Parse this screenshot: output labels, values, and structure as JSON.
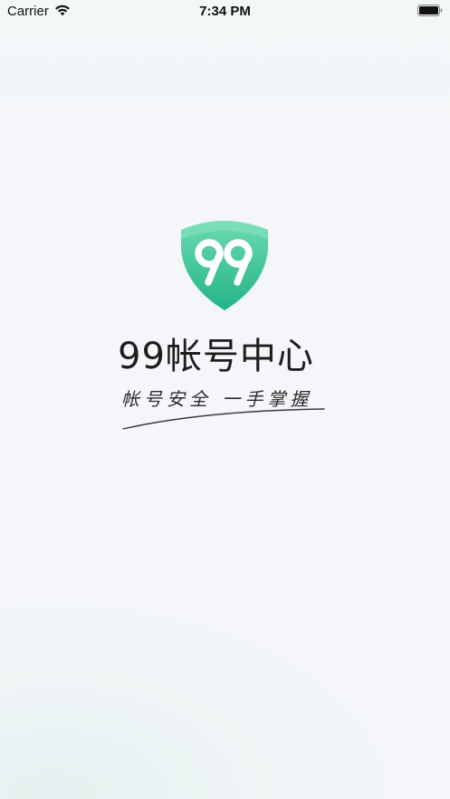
{
  "status_bar": {
    "carrier": "Carrier",
    "time": "7:34 PM",
    "wifi_icon": "wifi-icon",
    "battery_icon": "battery-full-icon"
  },
  "splash": {
    "logo_icon": "shield-99-logo-icon",
    "logo_text": "99",
    "title": "99帐号中心",
    "slogan": "帐号安全 一手掌握"
  },
  "colors": {
    "background": "#f4f6f9",
    "brand_green": "#2dbd8f",
    "brand_green_light": "#5fd3a8",
    "text_dark": "#1e1e1e"
  }
}
